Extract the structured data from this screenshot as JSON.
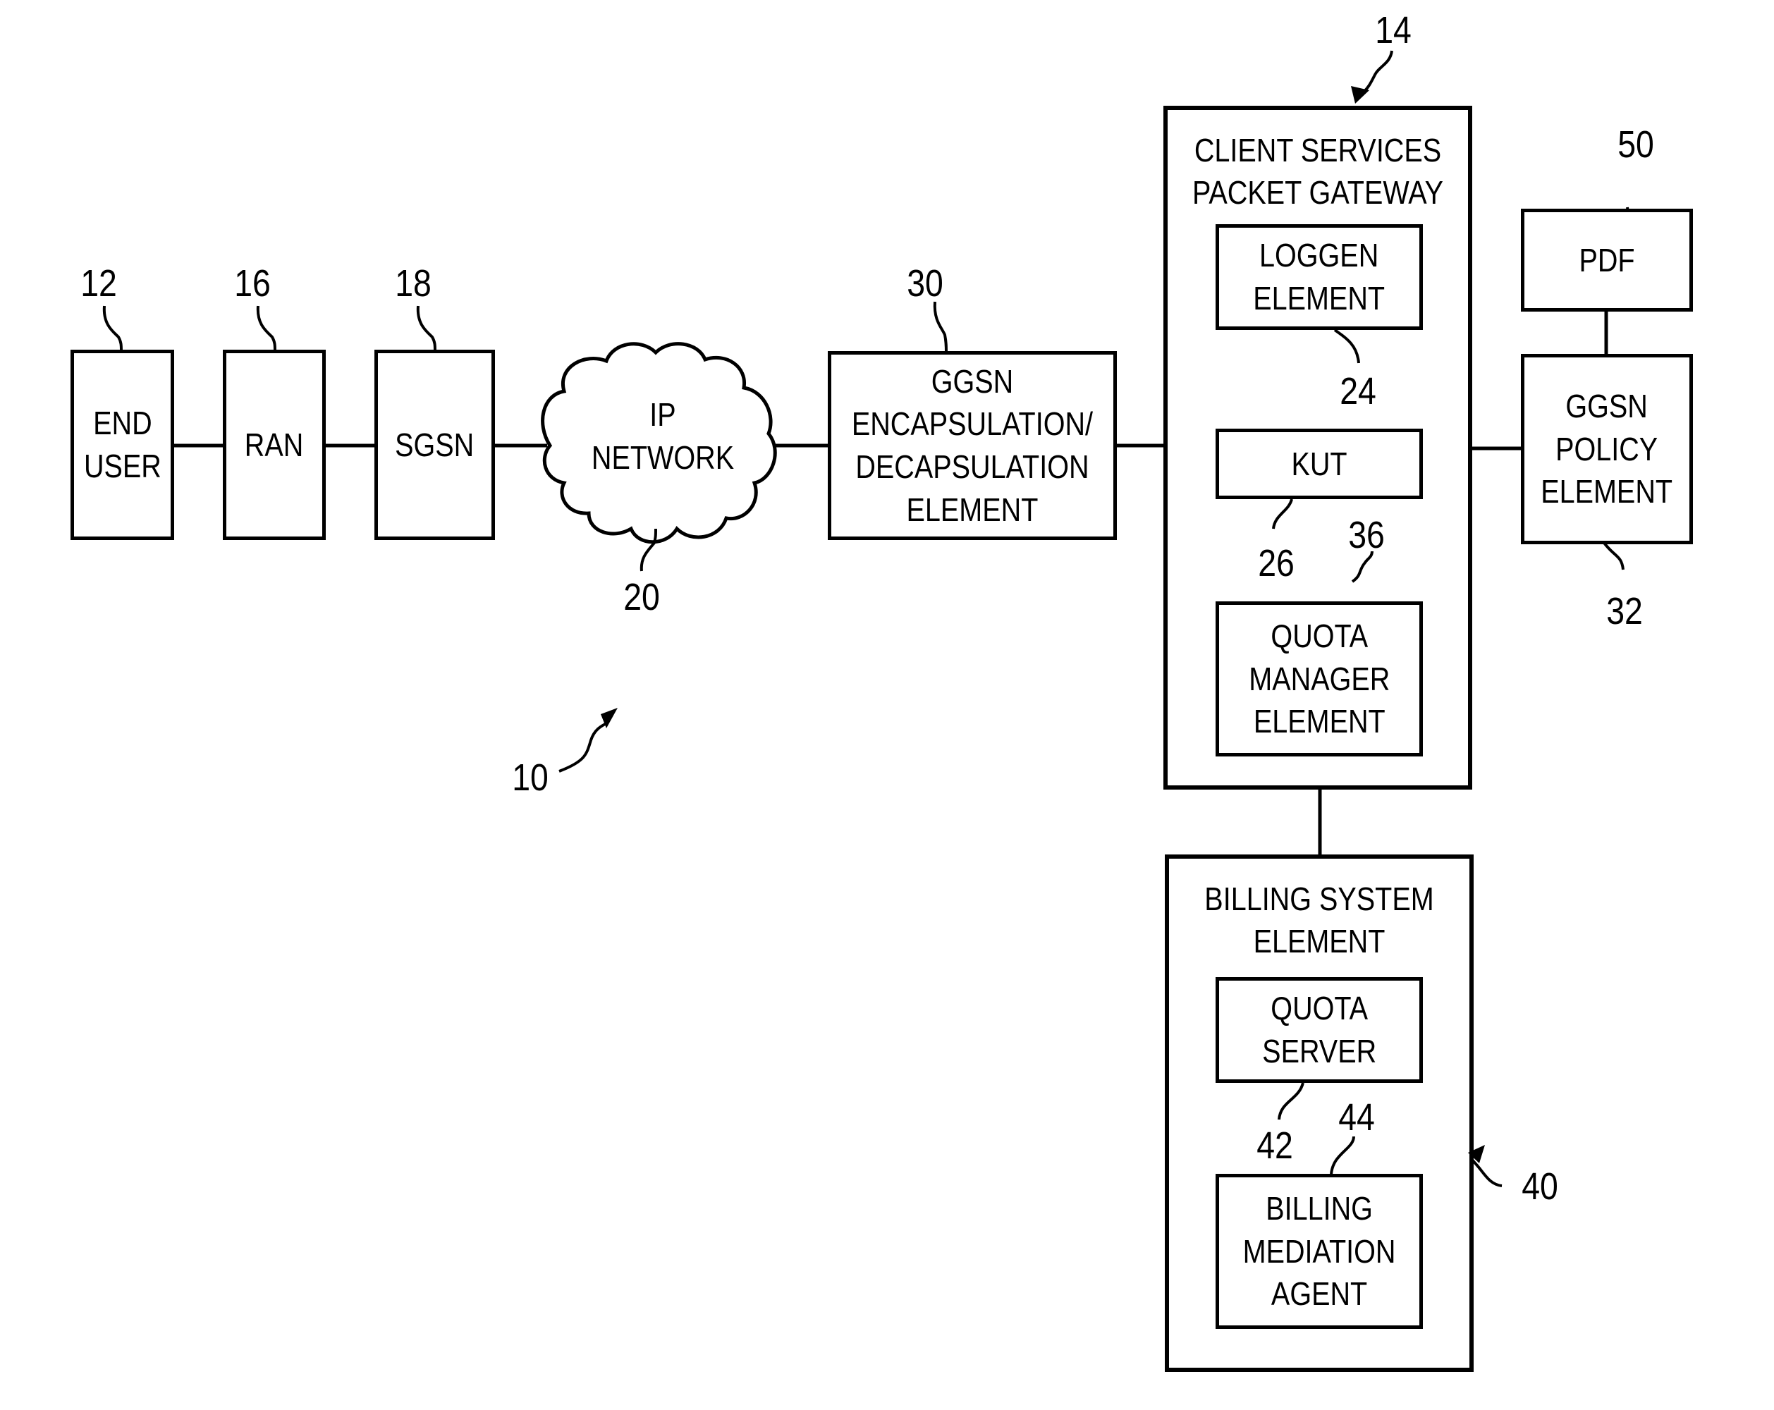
{
  "figure": {
    "system_ref": "10",
    "nodes": {
      "end_user": {
        "ref": "12",
        "lines": [
          "END",
          "USER"
        ]
      },
      "ran": {
        "ref": "16",
        "lines": [
          "RAN"
        ]
      },
      "sgsn": {
        "ref": "18",
        "lines": [
          "SGSN"
        ]
      },
      "ip_network": {
        "ref": "20",
        "lines": [
          "IP",
          "NETWORK"
        ]
      },
      "ggsn_encap": {
        "ref": "30",
        "lines": [
          "GGSN",
          "ENCAPSULATION/",
          "DECAPSULATION",
          "ELEMENT"
        ]
      },
      "cspg": {
        "ref": "14",
        "title_lines": [
          "CLIENT SERVICES",
          "PACKET GATEWAY"
        ],
        "loggen": {
          "ref": "24",
          "lines": [
            "LOGGEN",
            "ELEMENT"
          ]
        },
        "kut": {
          "ref": "26",
          "lines": [
            "KUT"
          ]
        },
        "quota_manager": {
          "ref": "36",
          "lines": [
            "QUOTA",
            "MANAGER",
            "ELEMENT"
          ]
        }
      },
      "pdf": {
        "ref": "50",
        "lines": [
          "PDF"
        ]
      },
      "ggsn_policy": {
        "ref": "32",
        "lines": [
          "GGSN",
          "POLICY",
          "ELEMENT"
        ]
      },
      "billing": {
        "ref": "40",
        "title_lines": [
          "BILLING SYSTEM",
          "ELEMENT"
        ],
        "quota_server": {
          "ref": "42",
          "lines": [
            "QUOTA",
            "SERVER"
          ]
        },
        "billing_mediation": {
          "ref": "44",
          "lines": [
            "BILLING",
            "MEDIATION",
            "AGENT"
          ]
        }
      }
    },
    "connections": [
      [
        "end_user",
        "ran"
      ],
      [
        "ran",
        "sgsn"
      ],
      [
        "sgsn",
        "ip_network"
      ],
      [
        "ip_network",
        "ggsn_encap"
      ],
      [
        "ggsn_encap",
        "cspg"
      ],
      [
        "cspg",
        "ggsn_policy"
      ],
      [
        "pdf",
        "ggsn_policy"
      ],
      [
        "cspg",
        "billing"
      ]
    ]
  }
}
